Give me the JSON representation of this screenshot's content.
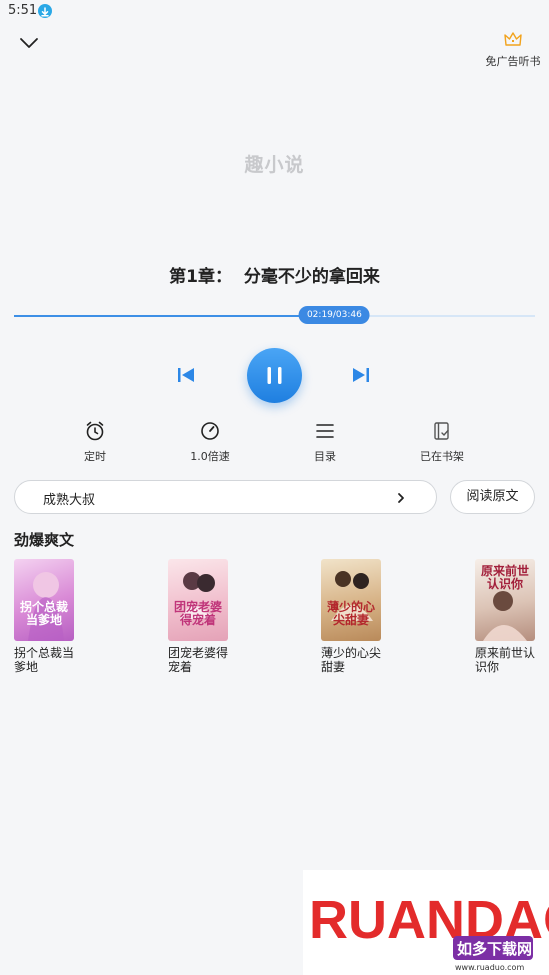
{
  "status_bar": {
    "time": "5:51"
  },
  "header": {
    "ad_free_label": "免广告听书"
  },
  "cover": {
    "logo_text": "趣小说"
  },
  "chapter": {
    "title": "第1章： 分毫不少的拿回来"
  },
  "player": {
    "time_readout": "02:19/03:46",
    "progress_fraction": 0.615
  },
  "toolbar": {
    "timer_label": "定时",
    "speed_label": "1.0倍速",
    "catalog_label": "目录",
    "shelf_label": "已在书架"
  },
  "voice": {
    "current": "成熟大叔"
  },
  "read_original_label": "阅读原文",
  "recommend": {
    "title": "劲爆爽文",
    "books": [
      {
        "title": "拐个总裁当爹地",
        "cover_text": "拐个总裁当爹地",
        "cover_color": "#e8a8e0"
      },
      {
        "title": "团宠老婆得宠着",
        "cover_text": "团宠老婆得宠着",
        "cover_color": "#f3c6cf"
      },
      {
        "title": "薄少的心尖甜妻",
        "cover_text": "薄少的心尖甜妻",
        "cover_color": "#d9b38a"
      },
      {
        "title": "原来前世认识你",
        "cover_text": "原来前世认识你",
        "cover_color": "#d8c1b3"
      }
    ]
  },
  "watermark": {
    "brand": "RUANDAO",
    "subtitle": "如多下载网",
    "url": "www.ruaduo.com"
  },
  "colors": {
    "accent": "#3b89e3",
    "background": "#f5f6f8"
  }
}
